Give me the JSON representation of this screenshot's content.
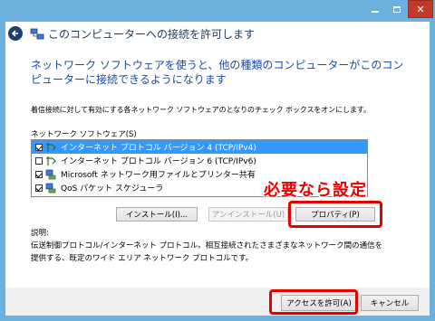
{
  "window": {
    "title": "このコンピューターへの接続を許可します",
    "controls": {
      "minimize": "minimize-icon",
      "maximize": "maximize-icon",
      "close": "close-icon"
    }
  },
  "content": {
    "heading": "ネットワーク ソフトウェアを使うと、他の種類のコンピューターがこのコンピューターに接続できるようになります",
    "instruction": "着信接続に対して有効にする各ネットワーク ソフトウェアのとなりのチェック ボックスをオンにします。",
    "list_label": "ネットワーク ソフトウェア(S)",
    "items": [
      {
        "label": "インターネット プロトコル バージョン 4 (TCP/IPv4)",
        "checked": true,
        "selected": true,
        "icon": "network-protocol-icon"
      },
      {
        "label": "インターネット プロトコル バージョン 6 (TCP/IPv6)",
        "checked": false,
        "selected": false,
        "icon": "network-protocol-icon"
      },
      {
        "label": "Microsoft ネットワーク用ファイルとプリンター共有",
        "checked": true,
        "selected": false,
        "icon": "network-service-icon"
      },
      {
        "label": "QoS パケット スケジューラ",
        "checked": true,
        "selected": false,
        "icon": "network-service-icon"
      }
    ],
    "buttons": {
      "install": "インストール(I)...",
      "uninstall": "アンインストール(U)",
      "properties": "プロパティ(P)"
    },
    "callout": "必要なら設定",
    "description_label": "説明:",
    "description": "伝送制御プロトコル/インターネット プロトコル。相互接続されたさまざまなネットワーク間の通信を提供する、既定のワイド エリア ネットワーク プロトコルです。"
  },
  "footer": {
    "allow": "アクセスを許可(A)",
    "cancel": "キャンセル"
  },
  "colors": {
    "window_frame": "#6cb1de",
    "heading": "#1a4a9c",
    "highlight_box": "#e60000",
    "selection": "#3399ff"
  }
}
